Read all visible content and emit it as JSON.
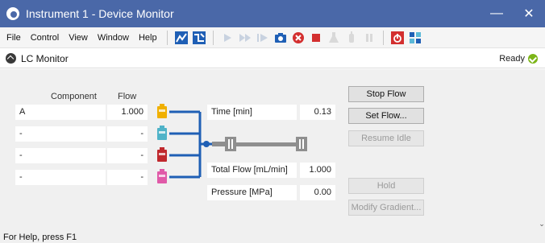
{
  "window": {
    "title": "Instrument 1 - Device Monitor"
  },
  "menu": [
    "File",
    "Control",
    "View",
    "Window",
    "Help"
  ],
  "toolbar_icons": [
    "chart-icon",
    "method-icon",
    "play-icon",
    "fast-forward-icon",
    "step-icon",
    "snapshot-icon",
    "abort-icon",
    "stop-icon",
    "flask-icon",
    "lamp-icon",
    "pause-icon",
    "power-icon",
    "network-icon"
  ],
  "panel": {
    "title": "LC Monitor",
    "status": "Ready"
  },
  "table": {
    "col_component": "Component",
    "col_flow": "Flow",
    "rows": [
      {
        "component": "A",
        "flow": "1.000",
        "color": "#f0b000"
      },
      {
        "component": "-",
        "flow": "-",
        "color": "#4fb3c8"
      },
      {
        "component": "-",
        "flow": "-",
        "color": "#c0282d"
      },
      {
        "component": "-",
        "flow": "-",
        "color": "#e05aa8"
      }
    ]
  },
  "readouts": {
    "time_label": "Time [min]",
    "time_value": "0.13",
    "total_flow_label": "Total Flow [mL/min]",
    "total_flow_value": "1.000",
    "pressure_label": "Pressure [MPa]",
    "pressure_value": "0.00"
  },
  "buttons": {
    "stop_flow": "Stop Flow",
    "set_flow": "Set Flow...",
    "resume_idle": "Resume Idle",
    "hold": "Hold",
    "modify_gradient": "Modify Gradient..."
  },
  "statusbar": "For Help, press F1",
  "colors": {
    "titlebar": "#4a68a8",
    "pipe": "#1f5fb5",
    "column": "#8f8f8f"
  }
}
